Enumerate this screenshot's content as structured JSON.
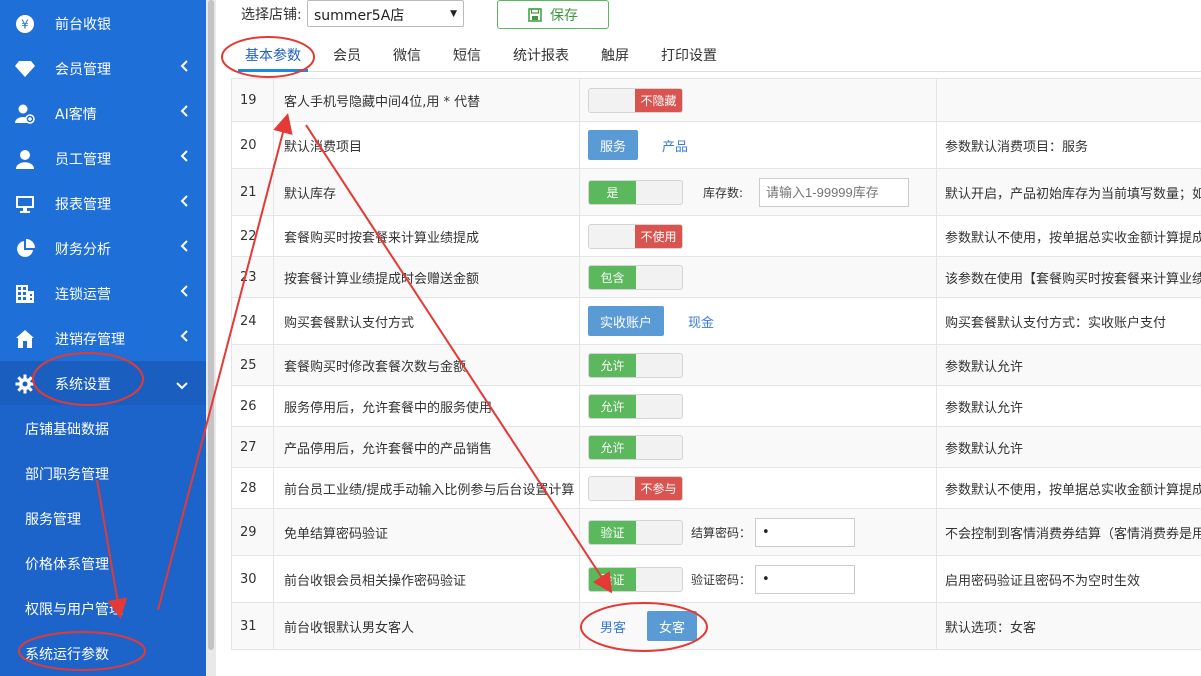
{
  "sidebar": {
    "items": [
      {
        "label": "前台收银",
        "icon": "yen-icon",
        "has_chevron": false
      },
      {
        "label": "会员管理",
        "icon": "diamond-icon",
        "has_chevron": true
      },
      {
        "label": "AI客情",
        "icon": "user-plus-icon",
        "has_chevron": true
      },
      {
        "label": "员工管理",
        "icon": "person-icon",
        "has_chevron": true
      },
      {
        "label": "报表管理",
        "icon": "monitor-icon",
        "has_chevron": true
      },
      {
        "label": "财务分析",
        "icon": "pie-icon",
        "has_chevron": true
      },
      {
        "label": "连锁运营",
        "icon": "building-icon",
        "has_chevron": true
      },
      {
        "label": "进销存管理",
        "icon": "home-icon",
        "has_chevron": true
      },
      {
        "label": "系统设置",
        "icon": "gear-icon",
        "has_chevron": true
      }
    ],
    "submenu": [
      {
        "label": "店铺基础数据"
      },
      {
        "label": "部门职务管理"
      },
      {
        "label": "服务管理"
      },
      {
        "label": "价格体系管理"
      },
      {
        "label": "权限与用户管理"
      },
      {
        "label": "系统运行参数"
      }
    ]
  },
  "toolbar": {
    "shop_label": "选择店铺:",
    "shop_value": "summer5A店",
    "save_label": "保存"
  },
  "tabs": [
    {
      "label": "基本参数",
      "active": true
    },
    {
      "label": "会员"
    },
    {
      "label": "微信"
    },
    {
      "label": "短信"
    },
    {
      "label": "统计报表"
    },
    {
      "label": "触屏"
    },
    {
      "label": "打印设置"
    }
  ],
  "rows": [
    {
      "num": "19",
      "name": "客人手机号隐藏中间4位,用 * 代替",
      "toggle_off": "不隐藏",
      "desc": ""
    },
    {
      "num": "20",
      "name": "默认消费项目",
      "btn": "服务",
      "link": "产品",
      "desc": "参数默认消费项目：服务"
    },
    {
      "num": "21",
      "name": "默认库存",
      "toggle_on": "是",
      "extra_label": "库存数:",
      "extra_placeholder": "请输入1-99999库存",
      "desc": "默认开启，产品初始库存为当前填写数量；如果"
    },
    {
      "num": "22",
      "name": "套餐购买时按套餐来计算业绩提成",
      "toggle_off": "不使用",
      "desc": "参数默认不使用，按单据总实收金额计算提成业绩"
    },
    {
      "num": "23",
      "name": "按套餐计算业绩提成时会赠送金额",
      "toggle_on": "包含",
      "desc": "该参数在使用【套餐购买时按套餐来计算业绩提成"
    },
    {
      "num": "24",
      "name": "购买套餐默认支付方式",
      "btn": "实收账户",
      "link": "现金",
      "desc": "购买套餐默认支付方式：实收账户支付"
    },
    {
      "num": "25",
      "name": "套餐购买时修改套餐次数与金额",
      "toggle_on": "允许",
      "desc": "参数默认允许"
    },
    {
      "num": "26",
      "name": "服务停用后，允许套餐中的服务使用",
      "toggle_on": "允许",
      "desc": "参数默认允许"
    },
    {
      "num": "27",
      "name": "产品停用后，允许套餐中的产品销售",
      "toggle_on": "允许",
      "desc": "参数默认允许"
    },
    {
      "num": "28",
      "name": "前台员工业绩/提成手动输入比例参与后台设置计算",
      "toggle_off": "不参与",
      "desc": "参数默认不使用，按单据总实收金额计算提成业绩"
    },
    {
      "num": "29",
      "name": "免单结算密码验证",
      "toggle_on": "验证",
      "extra_label": "结算密码：",
      "extra_value": "•",
      "desc": "不会控制到客情消费券结算（客情消费券是用的免"
    },
    {
      "num": "30",
      "name": "前台收银会员相关操作密码验证",
      "toggle_on": "验证",
      "extra_label": "验证密码：",
      "extra_value": "•",
      "desc": "启用密码验证且密码不为空时生效"
    },
    {
      "num": "31",
      "name": "前台收银默认男女客人",
      "link_first": "男客",
      "btn": "女客",
      "desc": "默认选项：女客"
    }
  ],
  "colors": {
    "sidebar_bg": "#1f6fd8",
    "toggle_on": "#5cb85c",
    "toggle_off": "#d9534f",
    "btn_blue": "#5b9bd5",
    "annotation_red": "#e53935"
  }
}
